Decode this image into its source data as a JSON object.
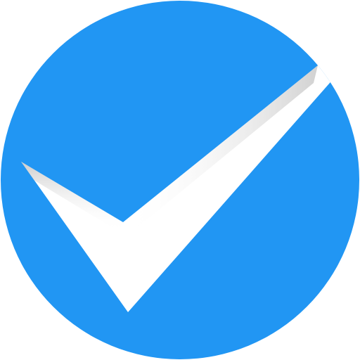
{
  "icon": {
    "name": "checkmark-circle-icon",
    "circle_color": "#2196F3",
    "check_color": "#FFFFFF",
    "shadow_color": "#9E9E9E",
    "background_color": "#FFFFFF"
  }
}
